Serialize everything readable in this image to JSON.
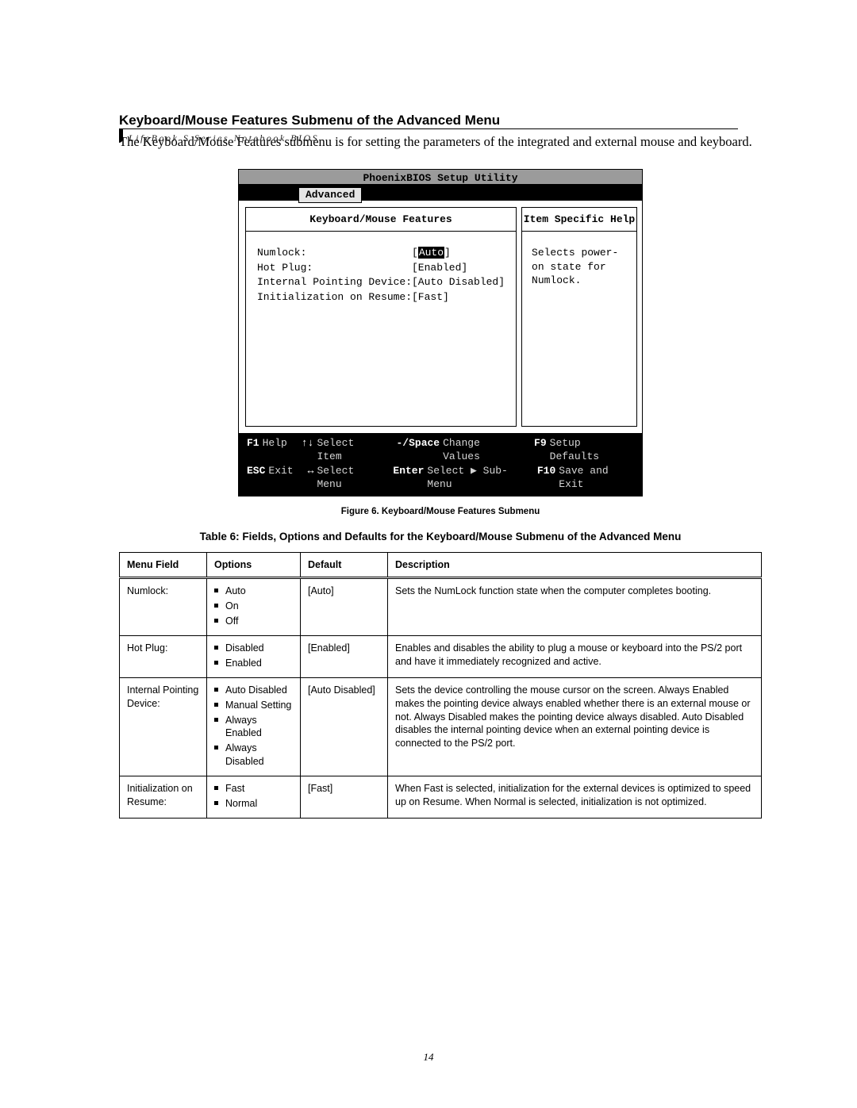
{
  "header_running": "LifeBook S Series Notebook BIOS",
  "section_title": "Keyboard/Mouse Features Submenu of the Advanced Menu",
  "intro": "The Keyboard/Mouse Features submenu is for setting the parameters of the integrated and external mouse and keyboard.",
  "bios": {
    "titlebar": "PhoenixBIOS Setup Utility",
    "tab": "Advanced",
    "left_heading": "Keyboard/Mouse Features",
    "right_heading": "Item Specific Help",
    "rows": [
      {
        "label": "Numlock:",
        "value": "[Auto]",
        "selected": true
      },
      {
        "label": "Hot Plug:",
        "value": "[Enabled]",
        "selected": false
      },
      {
        "label": "Internal Pointing Device:",
        "value": "[Auto Disabled]",
        "selected": false
      },
      {
        "label": "Initialization on Resume:",
        "value": "[Fast]",
        "selected": false
      }
    ],
    "help_text": "Selects power-on state for Numlock.",
    "footer": {
      "f1": "F1",
      "f1_label": "Help",
      "up_down": "Select Item",
      "minus_space": "-/Space",
      "minus_space_label": "Change Values",
      "f9": "F9",
      "f9_label": "Setup Defaults",
      "esc": "ESC",
      "esc_label": "Exit",
      "left_right": "Select Menu",
      "enter": "Enter",
      "enter_label": "Select ▶ Sub-Menu",
      "f10": "F10",
      "f10_label": "Save and Exit"
    }
  },
  "figure_caption": "Figure 6.   Keyboard/Mouse Features Submenu",
  "table_caption": "Table 6: Fields, Options and Defaults for the Keyboard/Mouse Submenu of the Advanced Menu",
  "table_headers": {
    "menu": "Menu Field",
    "options": "Options",
    "default": "Default",
    "desc": "Description"
  },
  "table_rows": [
    {
      "menu": "Numlock:",
      "options": [
        "Auto",
        "On",
        "Off"
      ],
      "default": "[Auto]",
      "desc": "Sets the NumLock function state when the computer completes booting."
    },
    {
      "menu": "Hot Plug:",
      "options": [
        "Disabled",
        "Enabled"
      ],
      "default": "[Enabled]",
      "desc": "Enables and disables the ability to plug a mouse or keyboard into the PS/2 port and have it immediately recognized and active."
    },
    {
      "menu": "Internal Pointing Device:",
      "options": [
        "Auto Disabled",
        "Manual Setting",
        "Always Enabled",
        "Always Disabled"
      ],
      "default": "[Auto Disabled]",
      "desc": "Sets the device controlling the mouse cursor on the screen. Always Enabled makes the pointing device always enabled whether there is an external mouse or not. Always Disabled makes the pointing device always disabled. Auto Disabled disables the internal pointing device when an external pointing device is connected to the PS/2 port."
    },
    {
      "menu": "Initialization on Resume:",
      "options": [
        "Fast",
        "Normal"
      ],
      "default": "[Fast]",
      "desc": "When Fast is selected, initialization for the external devices is optimized to speed up on Resume. When Normal is selected, initialization is not optimized."
    }
  ],
  "page_number": "14"
}
